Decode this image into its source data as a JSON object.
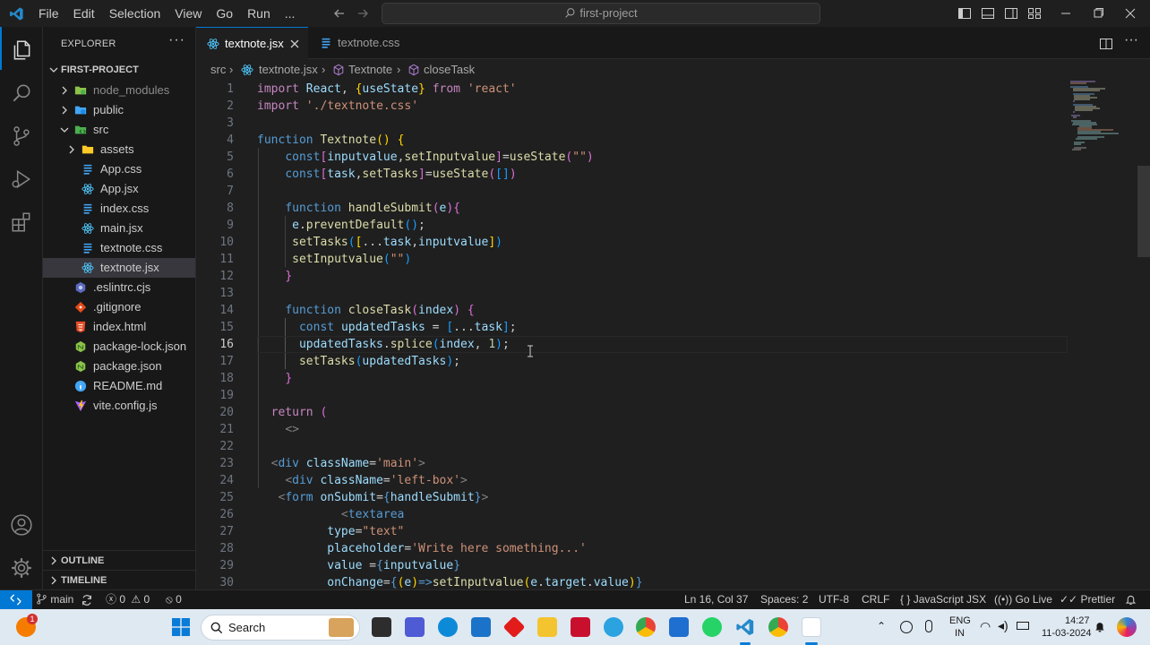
{
  "titlebar": {
    "menus": [
      "File",
      "Edit",
      "Selection",
      "View",
      "Go",
      "Run",
      "..."
    ],
    "search_text": "first-project"
  },
  "tabs": [
    {
      "label": "textnote.jsx",
      "active": true
    },
    {
      "label": "textnote.css",
      "active": false
    }
  ],
  "breadcrumb": [
    "src",
    "textnote.jsx",
    "Textnote",
    "closeTask"
  ],
  "sidebar": {
    "title": "EXPLORER",
    "project": "FIRST-PROJECT",
    "items": [
      {
        "label": "node_modules",
        "type": "folder",
        "indent": 1
      },
      {
        "label": "public",
        "type": "folder",
        "indent": 1
      },
      {
        "label": "src",
        "type": "folder-open",
        "indent": 1
      },
      {
        "label": "assets",
        "type": "folder",
        "indent": 2
      },
      {
        "label": "App.css",
        "type": "css",
        "indent": 2
      },
      {
        "label": "App.jsx",
        "type": "react",
        "indent": 2
      },
      {
        "label": "index.css",
        "type": "css",
        "indent": 2
      },
      {
        "label": "main.jsx",
        "type": "react",
        "indent": 2
      },
      {
        "label": "textnote.css",
        "type": "css",
        "indent": 2
      },
      {
        "label": "textnote.jsx",
        "type": "react",
        "indent": 2,
        "active": true
      },
      {
        "label": ".eslintrc.cjs",
        "type": "eslint",
        "indent": 1
      },
      {
        "label": ".gitignore",
        "type": "git",
        "indent": 1
      },
      {
        "label": "index.html",
        "type": "html",
        "indent": 1
      },
      {
        "label": "package-lock.json",
        "type": "json",
        "indent": 1
      },
      {
        "label": "package.json",
        "type": "json",
        "indent": 1
      },
      {
        "label": "README.md",
        "type": "info",
        "indent": 1
      },
      {
        "label": "vite.config.js",
        "type": "js",
        "indent": 1
      }
    ],
    "outline": "OUTLINE",
    "timeline": "TIMELINE"
  },
  "editor": {
    "current_line": 16,
    "lines": [
      "1",
      "2",
      "3",
      "4",
      "5",
      "6",
      "7",
      "8",
      "9",
      "10",
      "11",
      "12",
      "13",
      "14",
      "15",
      "16",
      "17",
      "18",
      "19",
      "20",
      "21",
      "22",
      "23",
      "24",
      "25",
      "26",
      "27",
      "28",
      "29",
      "30"
    ]
  },
  "statusbar": {
    "branch": "main",
    "errors": "0",
    "warnings": "0",
    "ports": "0",
    "position": "Ln 16, Col 37",
    "spaces": "Spaces: 2",
    "encoding": "UTF-8",
    "eol": "CRLF",
    "language": "JavaScript JSX",
    "golive": "Go Live",
    "prettier": "Prettier"
  },
  "taskbar": {
    "search": "Search",
    "lang": "ENG",
    "region": "IN",
    "time": "14:27",
    "date": "11-03-2024",
    "notification_badge": "1"
  },
  "colors": {
    "accent": "#0078d4",
    "keyword": "#569cd6",
    "control": "#c586c0",
    "function": "#dcdcaa",
    "variable": "#9cdcfe",
    "string": "#ce9178"
  }
}
